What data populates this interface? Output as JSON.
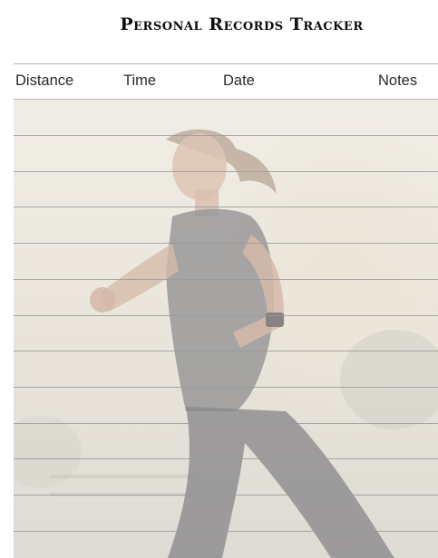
{
  "title": "Personal Records Tracker",
  "table": {
    "columns": [
      "Distance",
      "Time",
      "Date",
      "Notes"
    ],
    "blank_rows": 12
  },
  "colors": {
    "rule": "#9a9a9a",
    "title": "#0d0d0d"
  }
}
